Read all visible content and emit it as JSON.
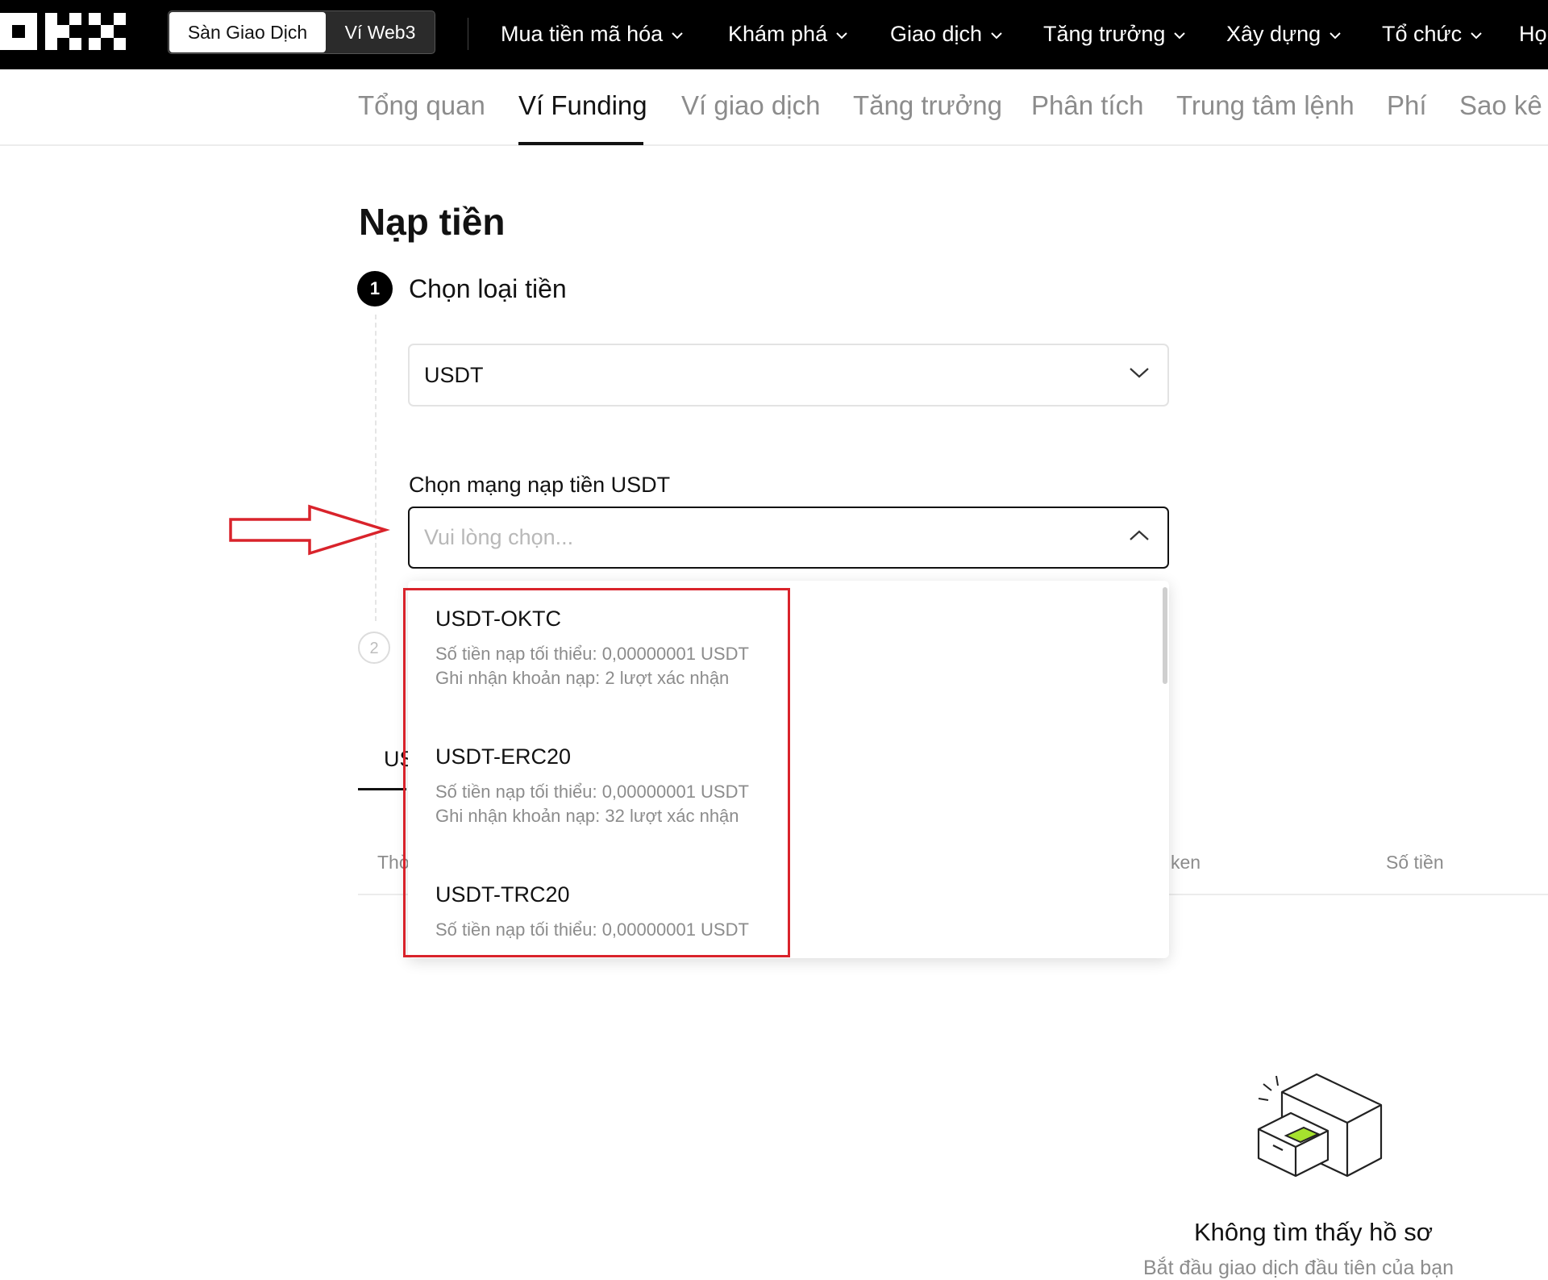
{
  "topbar": {
    "brand": "OKX",
    "segments": [
      "Sàn Giao Dịch",
      "Ví Web3"
    ],
    "nav": [
      "Mua tiền mã hóa",
      "Khám phá",
      "Giao dịch",
      "Tăng trưởng",
      "Xây dựng",
      "Tổ chức",
      "Họ"
    ]
  },
  "subnav": {
    "items": [
      "Tổng quan",
      "Ví Funding",
      "Ví giao dịch",
      "Tăng trưởng",
      "Phân tích",
      "Trung tâm lệnh",
      "Phí",
      "Sao kê t"
    ],
    "active": "Ví Funding"
  },
  "page": {
    "title": "Nạp tiền",
    "step1_number": "1",
    "step1_title": "Chọn loại tiền",
    "step2_number": "2",
    "coin_value": "USDT",
    "network_label": "Chọn mạng nạp tiền USDT",
    "network_placeholder": "Vui lòng chọn..."
  },
  "dropdown": {
    "options": [
      {
        "name": "USDT-OKTC",
        "min": "Số tiền nạp tối thiểu: 0,00000001 USDT",
        "confirm": "Ghi nhận khoản nạp: 2 lượt xác nhận"
      },
      {
        "name": "USDT-ERC20",
        "min": "Số tiền nạp tối thiểu: 0,00000001 USDT",
        "confirm": "Ghi nhận khoản nạp: 32 lượt xác nhận"
      },
      {
        "name": "USDT-TRC20",
        "min": "Số tiền nạp tối thiểu: 0,00000001 USDT",
        "confirm": ""
      }
    ]
  },
  "background": {
    "tab_fragment": "US",
    "col_fragment_left": "Thờ",
    "col_fragment_token": "ken",
    "col_amount": "Số tiền"
  },
  "empty_state": {
    "title": "Không tìm thấy hồ sơ",
    "subtitle": "Bắt đầu giao dịch đầu tiên của bạn"
  },
  "colors": {
    "topbar_bg": "#000000",
    "annotation_red": "#d9232b",
    "accent_green": "#a6e22e"
  },
  "icons": [
    "okx-logo-icon",
    "chevron-down-icon",
    "chevron-up-icon",
    "arrow-annotation-icon",
    "empty-drawer-icon"
  ]
}
